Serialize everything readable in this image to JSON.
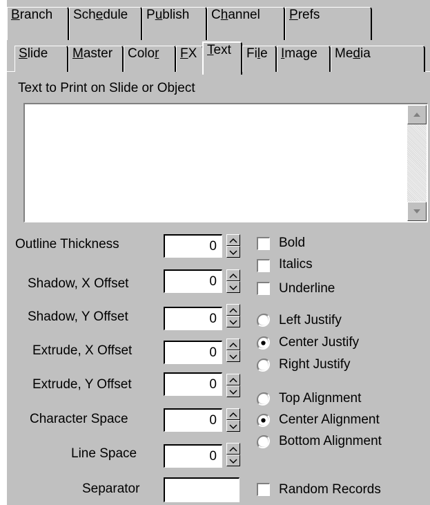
{
  "top_tabs": [
    {
      "pre": "",
      "key": "B",
      "post": "ranch"
    },
    {
      "pre": "Sch",
      "key": "e",
      "post": "dule"
    },
    {
      "pre": "P",
      "key": "u",
      "post": "blish"
    },
    {
      "pre": "C",
      "key": "h",
      "post": "annel"
    },
    {
      "pre": "",
      "key": "P",
      "post": "refs"
    }
  ],
  "sub_tabs": [
    {
      "pre": "",
      "key": "S",
      "post": "lide"
    },
    {
      "pre": "",
      "key": "M",
      "post": "aster"
    },
    {
      "pre": "Colo",
      "key": "r",
      "post": ""
    },
    {
      "pre": "",
      "key": "F",
      "post": "X"
    },
    {
      "pre": "",
      "key": "T",
      "post": "ext"
    },
    {
      "pre": "Fi",
      "key": "l",
      "post": "e"
    },
    {
      "pre": "",
      "key": "I",
      "post": "mage"
    },
    {
      "pre": "Me",
      "key": "d",
      "post": "ia"
    }
  ],
  "text_section": {
    "label": "Text to Print on Slide or Object",
    "value": ""
  },
  "fields": [
    {
      "label": "Outline Thickness",
      "value": "0"
    },
    {
      "label": "Shadow, X Offset",
      "value": "0"
    },
    {
      "label": "Shadow, Y Offset",
      "value": "0"
    },
    {
      "label": "Extrude, X Offset",
      "value": "0"
    },
    {
      "label": "Extrude, Y Offset",
      "value": "0"
    },
    {
      "label": "Character Space",
      "value": "0"
    },
    {
      "label": "Line Space",
      "value": "0"
    }
  ],
  "separator": {
    "label": "Separator",
    "value": ""
  },
  "checkboxes": {
    "bold": {
      "label": "Bold",
      "checked": false
    },
    "italics": {
      "label": "Italics",
      "checked": false
    },
    "underline": {
      "label": "Underline",
      "checked": false
    },
    "random_records": {
      "label": "Random Records",
      "checked": false
    }
  },
  "justify": {
    "options": [
      "Left Justify",
      "Center Justify",
      "Right Justify"
    ],
    "selected": "Center Justify"
  },
  "alignment": {
    "options": [
      "Top Alignment",
      "Center Alignment",
      "Bottom Alignment"
    ],
    "selected": "Center Alignment"
  },
  "colors": {
    "face": "#c0c0c0",
    "highlight": "#ffffff",
    "shadow": "#808080",
    "dark": "#000000"
  }
}
